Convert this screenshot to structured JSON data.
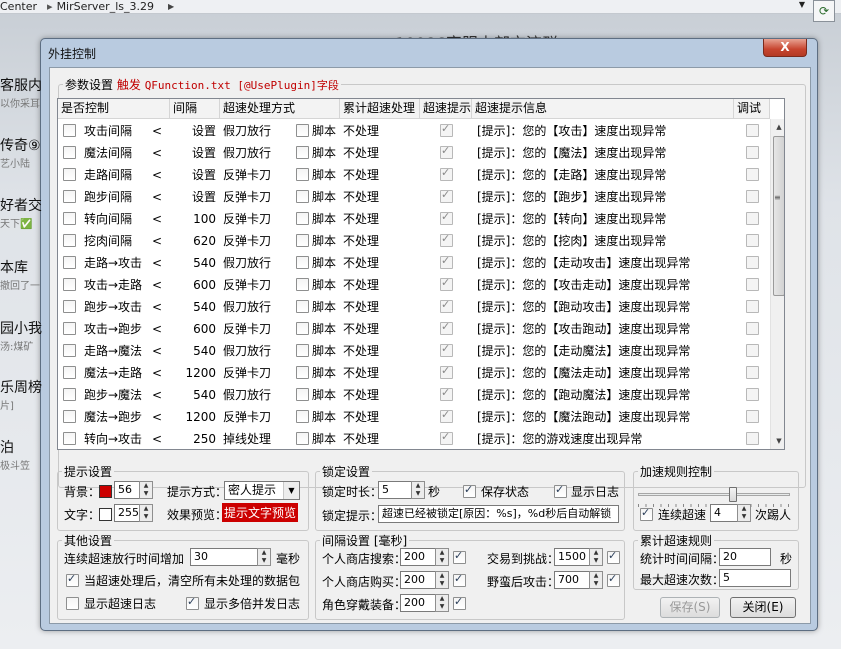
{
  "background": {
    "breadcrumb": [
      "Center",
      "MirServer_ls_3.29"
    ],
    "chat_title": "10086客服内部交流群",
    "left_items": [
      {
        "title": "客服内",
        "sub": "以你采耳"
      },
      {
        "title": "传奇⑨",
        "sub": "艺小陆"
      },
      {
        "title": "好者交",
        "sub": "天下✅"
      },
      {
        "title": "本库",
        "sub": "撤回了一"
      },
      {
        "title": "园小我",
        "sub": "汤:煤矿"
      },
      {
        "title": "乐周榜",
        "sub": "片]"
      },
      {
        "title": "泊",
        "sub": "极斗笠"
      }
    ]
  },
  "window": {
    "title": "外挂控制",
    "close": "X"
  },
  "params": {
    "legend": "参数设置",
    "trigger": "触发",
    "trigger_file": "QFunction.txt [@UsePlugin]字段"
  },
  "table": {
    "headers": [
      "是否控制",
      "间隔",
      "超速处理方式",
      "累计超速处理",
      "超速提示",
      "超速提示信息",
      "调试"
    ],
    "script_label": "脚本",
    "rows": [
      {
        "name": "攻击间隔",
        "arrow": "<",
        "interval": "设置",
        "method": "假刀放行",
        "cumulative": "不处理",
        "msg": "[提示]：您的【攻击】速度出现异常"
      },
      {
        "name": "魔法间隔",
        "arrow": "<",
        "interval": "设置",
        "method": "假刀放行",
        "cumulative": "不处理",
        "msg": "[提示]：您的【魔法】速度出现异常"
      },
      {
        "name": "走路间隔",
        "arrow": "<",
        "interval": "设置",
        "method": "反弹卡刀",
        "cumulative": "不处理",
        "msg": "[提示]：您的【走路】速度出现异常"
      },
      {
        "name": "跑步间隔",
        "arrow": "<",
        "interval": "设置",
        "method": "反弹卡刀",
        "cumulative": "不处理",
        "msg": "[提示]：您的【跑步】速度出现异常"
      },
      {
        "name": "转向间隔",
        "arrow": "<",
        "interval": "100",
        "method": "反弹卡刀",
        "cumulative": "不处理",
        "msg": "[提示]：您的【转向】速度出现异常"
      },
      {
        "name": "挖肉间隔",
        "arrow": "<",
        "interval": "620",
        "method": "反弹卡刀",
        "cumulative": "不处理",
        "msg": "[提示]：您的【挖肉】速度出现异常"
      },
      {
        "name": "走路→攻击",
        "arrow": "<",
        "interval": "540",
        "method": "假刀放行",
        "cumulative": "不处理",
        "msg": "[提示]：您的【走动攻击】速度出现异常"
      },
      {
        "name": "攻击→走路",
        "arrow": "<",
        "interval": "600",
        "method": "反弹卡刀",
        "cumulative": "不处理",
        "msg": "[提示]：您的【攻击走动】速度出现异常"
      },
      {
        "name": "跑步→攻击",
        "arrow": "<",
        "interval": "540",
        "method": "假刀放行",
        "cumulative": "不处理",
        "msg": "[提示]：您的【跑动攻击】速度出现异常"
      },
      {
        "name": "攻击→跑步",
        "arrow": "<",
        "interval": "600",
        "method": "反弹卡刀",
        "cumulative": "不处理",
        "msg": "[提示]：您的【攻击跑动】速度出现异常"
      },
      {
        "name": "走路→魔法",
        "arrow": "<",
        "interval": "540",
        "method": "假刀放行",
        "cumulative": "不处理",
        "msg": "[提示]：您的【走动魔法】速度出现异常"
      },
      {
        "name": "魔法→走路",
        "arrow": "<",
        "interval": "1200",
        "method": "反弹卡刀",
        "cumulative": "不处理",
        "msg": "[提示]：您的【魔法走动】速度出现异常"
      },
      {
        "name": "跑步→魔法",
        "arrow": "<",
        "interval": "540",
        "method": "假刀放行",
        "cumulative": "不处理",
        "msg": "[提示]：您的【跑动魔法】速度出现异常"
      },
      {
        "name": "魔法→跑步",
        "arrow": "<",
        "interval": "1200",
        "method": "反弹卡刀",
        "cumulative": "不处理",
        "msg": "[提示]：您的【魔法跑动】速度出现异常"
      },
      {
        "name": "转向→攻击",
        "arrow": "<",
        "interval": "250",
        "method": "掉线处理",
        "cumulative": "不处理",
        "msg": "[提示]：您的游戏速度出现异常"
      }
    ]
  },
  "tips": {
    "legend": "提示设置",
    "bg_label": "背景：",
    "bg_value": "56",
    "bg_color": "#cc0000",
    "text_label": "文字：",
    "text_value": "255",
    "mode_label": "提示方式：",
    "mode_value": "密人提示",
    "preview_label": "效果预览：",
    "preview_text": "提示文字预览"
  },
  "lock": {
    "legend": "锁定设置",
    "duration_label": "锁定时长：",
    "duration_value": "5",
    "unit": "秒",
    "save_state": "保存状态",
    "show_log": "显示日志",
    "prompt_label": "锁定提示：",
    "prompt_value": "超速已经被锁定[原因：%s]，%d秒后自动解锁"
  },
  "accel": {
    "legend": "加速规则控制",
    "consecutive_label": "连续超速",
    "consecutive_value": "4",
    "kick": "次踢人"
  },
  "other": {
    "legend": "其他设置",
    "increase_label": "连续超速放行时间增加",
    "increase_value": "30",
    "unit": "毫秒",
    "clear_label": "当超速处理后，清空所有未处理的数据包",
    "show_speed_log": "显示超速日志",
    "show_multi_log": "显示多倍并发日志"
  },
  "interval": {
    "legend": "间隔设置 [毫秒]",
    "shop_search": {
      "label": "个人商店搜索：",
      "value": "200"
    },
    "shop_buy": {
      "label": "个人商店购买：",
      "value": "200"
    },
    "equip": {
      "label": "角色穿戴装备：",
      "value": "200"
    },
    "trade": {
      "label": "交易到挑战：",
      "value": "1500"
    },
    "brutal": {
      "label": "野蛮后攻击：",
      "value": "700"
    }
  },
  "cumulative": {
    "legend": "累计超速规则",
    "time_label": "统计时间间隔：",
    "time_value": "20",
    "unit": "秒",
    "max_label": "最大超速次数：",
    "max_value": "5"
  },
  "buttons": {
    "save": "保存(S)",
    "close": "关闭(E)"
  }
}
